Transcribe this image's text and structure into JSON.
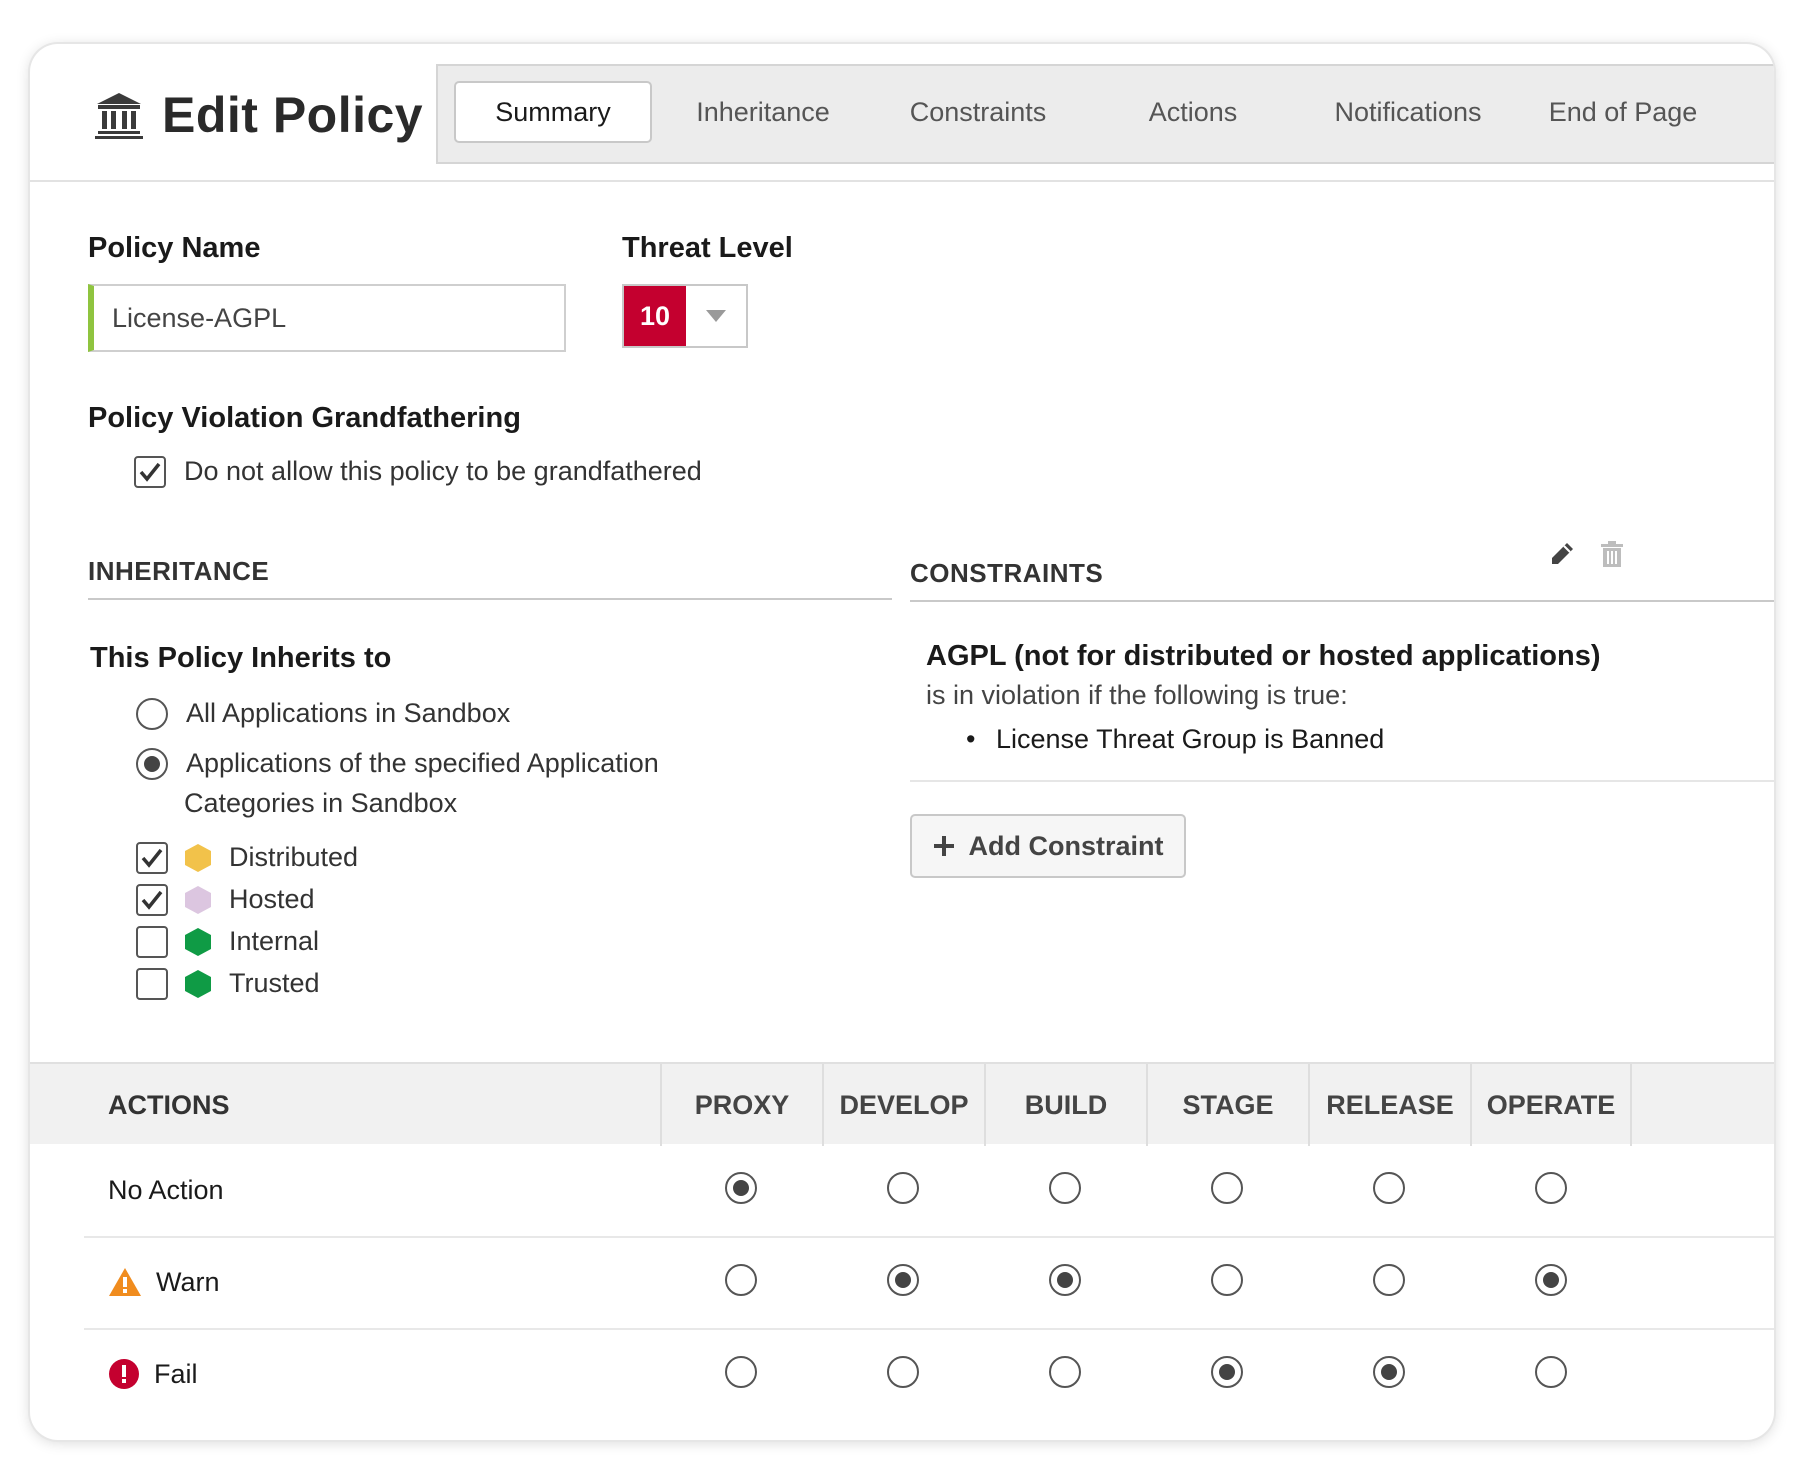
{
  "header": {
    "title": "Edit Policy",
    "tabs": [
      "Summary",
      "Inheritance",
      "Constraints",
      "Actions",
      "Notifications",
      "End of Page"
    ]
  },
  "form": {
    "policy_name_label": "Policy Name",
    "policy_name_value": "License-AGPL",
    "threat_level_label": "Threat Level",
    "threat_level_value": "10",
    "grandfather_label": "Policy Violation Grandfathering",
    "grandfather_option": "Do not allow this policy to be grandfathered",
    "grandfather_checked": true
  },
  "inheritance": {
    "section_title": "INHERITANCE",
    "heading": "This Policy Inherits to",
    "option_all": "All Applications in Sandbox",
    "option_specified_line1": "Applications of the specified Application",
    "option_specified_line2": "Categories in Sandbox",
    "selected": "specified",
    "categories": [
      {
        "name": "Distributed",
        "checked": true,
        "color": "#f2c24a"
      },
      {
        "name": "Hosted",
        "checked": true,
        "color": "#dcc6e0"
      },
      {
        "name": "Internal",
        "checked": false,
        "color": "#0f9b45"
      },
      {
        "name": "Trusted",
        "checked": false,
        "color": "#0f9b45"
      }
    ]
  },
  "constraints": {
    "section_title": "CONSTRAINTS",
    "name": "AGPL (not for distributed or hosted applications)",
    "description": "is in violation if the following is true:",
    "conditions": [
      "License Threat Group is Banned"
    ],
    "add_label": "Add Constraint"
  },
  "actions": {
    "title": "ACTIONS",
    "stages": [
      "PROXY",
      "DEVELOP",
      "BUILD",
      "STAGE",
      "RELEASE",
      "OPERATE"
    ],
    "rows": [
      {
        "label": "No Action",
        "icon": "",
        "selected": [
          true,
          false,
          false,
          false,
          false,
          false
        ]
      },
      {
        "label": "Warn",
        "icon": "warning-icon",
        "selected": [
          false,
          true,
          true,
          false,
          false,
          true
        ]
      },
      {
        "label": "Fail",
        "icon": "error-icon",
        "selected": [
          false,
          false,
          false,
          true,
          true,
          false
        ]
      }
    ]
  },
  "colors": {
    "threat": "#c4002f",
    "input_accent": "#8fc43f",
    "warn": "#f08c1e",
    "fail": "#c4002f"
  }
}
